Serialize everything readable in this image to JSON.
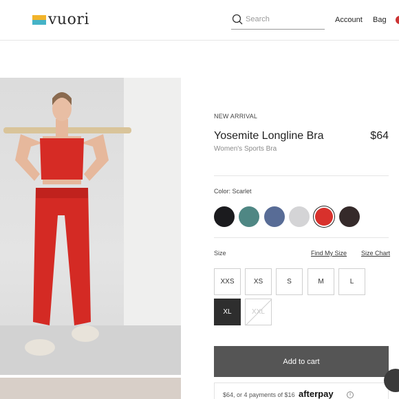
{
  "header": {
    "logo_text": "vuori",
    "search_placeholder": "Search",
    "account_label": "Account",
    "bag_label": "Bag"
  },
  "product": {
    "badge": "NEW ARRIVAL",
    "name": "Yosemite Longline Bra",
    "price": "$64",
    "subtitle": "Women's Sports Bra"
  },
  "color": {
    "label": "Color: Scarlet",
    "swatches": [
      {
        "name": "Black",
        "hex": "#1b1b1e"
      },
      {
        "name": "Teal",
        "hex": "#4f8784"
      },
      {
        "name": "Blue",
        "hex": "#586c96"
      },
      {
        "name": "Gray",
        "hex": "#d4d4d6"
      },
      {
        "name": "Scarlet",
        "hex": "#d8312c",
        "selected": true
      },
      {
        "name": "Brown",
        "hex": "#352a2a"
      }
    ]
  },
  "size": {
    "label": "Size",
    "find_my_size": "Find My Size",
    "size_chart": "Size Chart",
    "options": [
      "XXS",
      "XS",
      "S",
      "M",
      "L",
      "XL",
      "XXL"
    ],
    "selected": "XL",
    "unavailable": [
      "XXL"
    ]
  },
  "cart": {
    "add_label": "Add to cart"
  },
  "afterpay": {
    "text": "$64, or 4 payments of $16",
    "logo": "afterpay",
    "info": "i"
  }
}
